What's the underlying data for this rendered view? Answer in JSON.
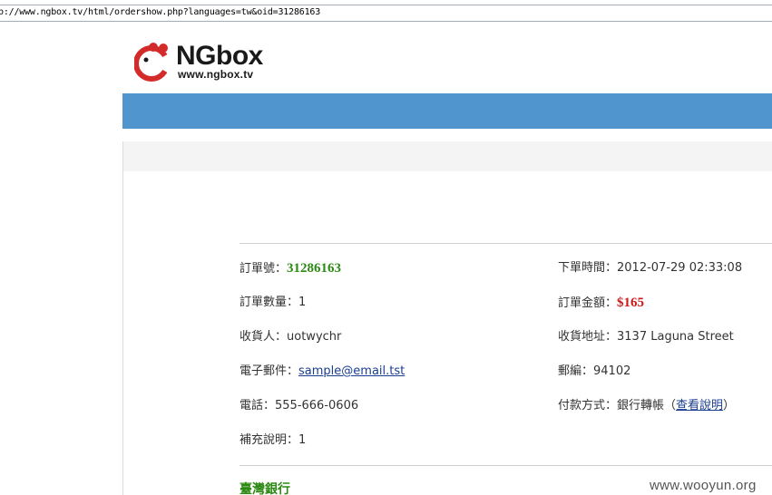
{
  "browser": {
    "url": "p://www.ngbox.tv/html/ordershow.php?languages=tw&oid=31286163"
  },
  "logo": {
    "brand": "NGbox",
    "site": "www.ngbox.tv",
    "color": "#d32a2a"
  },
  "order": {
    "number_label": "訂單號：",
    "number_value": "31286163",
    "time_label": "下單時間：",
    "time_value": "2012-07-29 02:33:08",
    "qty_label": "訂單數量：",
    "qty_value": "1",
    "amount_label": "訂單金額：",
    "amount_value": "$165",
    "receiver_label": "收貨人：",
    "receiver_value": "uotwychr",
    "address_label": "收貨地址：",
    "address_value": "3137 Laguna Street",
    "email_label": "電子郵件：",
    "email_value": "sample@email.tst",
    "zip_label": "郵編：",
    "zip_value": "94102",
    "phone_label": "電話：",
    "phone_value": "555-666-0606",
    "payment_label": "付款方式：",
    "payment_value": "銀行轉帳（",
    "payment_link": "查看說明",
    "payment_close": "）",
    "note_label": "補充說明：",
    "note_value": "1"
  },
  "bank": {
    "name": "臺灣銀行"
  },
  "watermark": "www.wooyun.org",
  "colors": {
    "bluebar": "#5095cd",
    "green": "#2c8a12",
    "red": "#cc1a1a",
    "link": "#1a3d8f"
  }
}
